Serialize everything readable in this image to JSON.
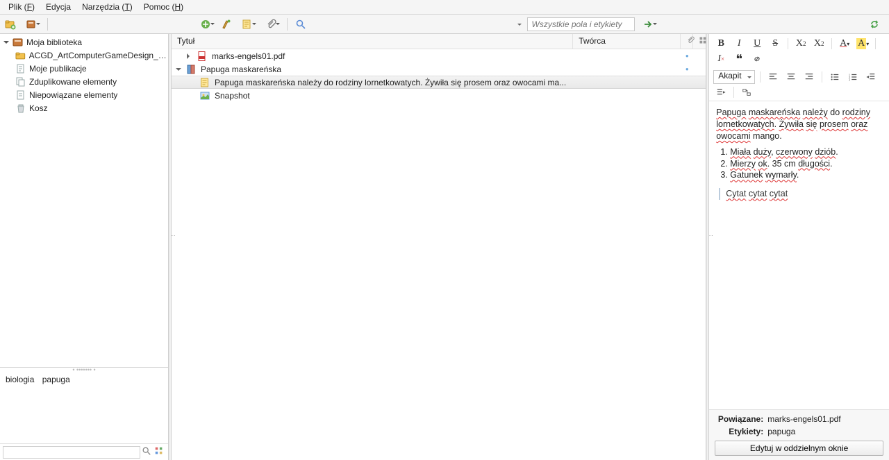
{
  "menu": {
    "file": "Plik",
    "file_key": "F",
    "edit": "Edycja",
    "tools": "Narzędzia",
    "tools_key": "T",
    "help": "Pomoc",
    "help_key": "H"
  },
  "toolbar": {
    "search_placeholder": "Wszystkie pola i etykiety"
  },
  "tree": {
    "root": "Moja biblioteka",
    "items": [
      "ACGD_ArtComputerGameDesign_C...",
      "Moje publikacje",
      "Zduplikowane elementy",
      "Niepowiązane elementy",
      "Kosz"
    ]
  },
  "tags": {
    "items": [
      "biologia",
      "papuga"
    ]
  },
  "columns": {
    "title": "Tytuł",
    "creator": "Twórca"
  },
  "items": [
    {
      "title": "marks-engels01.pdf",
      "kind": "pdf",
      "dot": true
    },
    {
      "title": "Papuga maskareńska",
      "kind": "book",
      "dot": true,
      "expanded": true
    },
    {
      "title": "Papuga maskareńska należy do rodziny lornetkowatych. Żywiła się prosem oraz owocami ma...",
      "kind": "note",
      "child": true,
      "selected": true
    },
    {
      "title": "Snapshot",
      "kind": "snapshot",
      "child": true
    }
  ],
  "note": {
    "para1": "Papuga maskareńska należy do rodziny lornetkowatych. Żywiła się prosem oraz owocami mango.",
    "li1": "Miała duży, czerwony dziób.",
    "li2": "Mierzy ok. 35 cm długości.",
    "li3": "Gatunek wymarły.",
    "quote": "Cytat cytat cytat"
  },
  "format": {
    "para_style": "Akapit"
  },
  "meta": {
    "related_label": "Powiązane:",
    "related_value": "marks-engels01.pdf",
    "tags_label": "Etykiety:",
    "tags_value": "papuga",
    "edit_btn": "Edytuj w oddzielnym oknie"
  }
}
